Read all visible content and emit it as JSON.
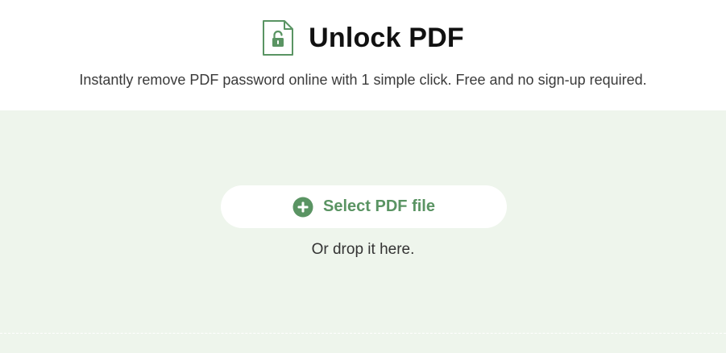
{
  "header": {
    "title": "Unlock PDF",
    "subtitle": "Instantly remove PDF password online with 1 simple click. Free and no sign-up required.",
    "icon": "unlocked-pdf-file-icon"
  },
  "dropzone": {
    "button_label": "Select PDF file",
    "button_icon": "plus-circle-icon",
    "hint": "Or drop it here."
  },
  "colors": {
    "accent": "#5a9463",
    "dropzone_background": "#eef5ec",
    "title_text": "#111111"
  }
}
